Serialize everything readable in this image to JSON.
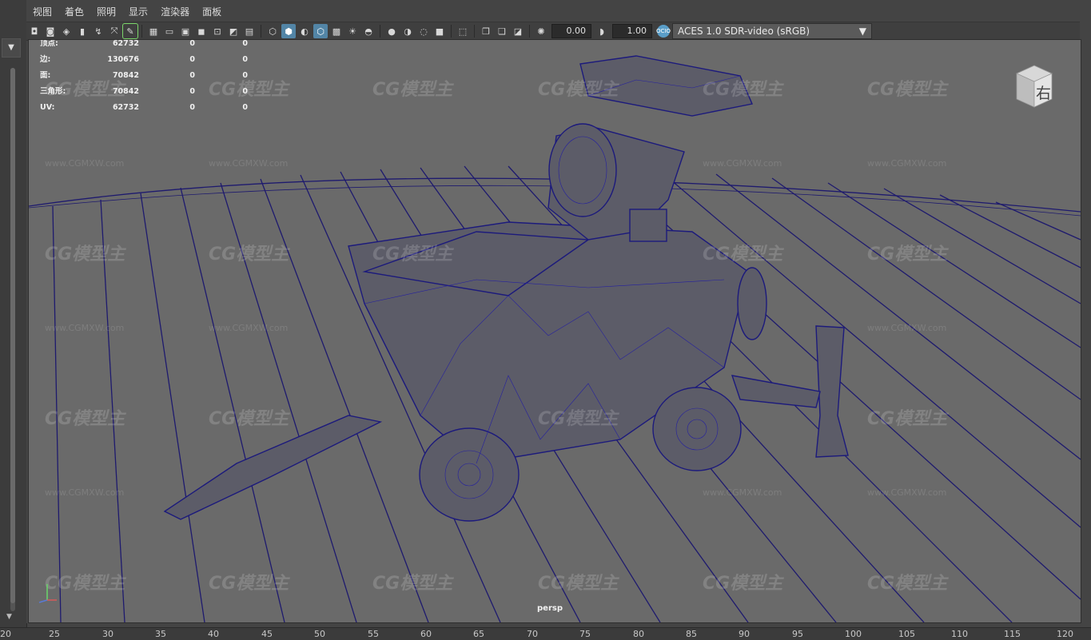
{
  "menu": [
    "视图",
    "着色",
    "照明",
    "显示",
    "渲染器",
    "面板"
  ],
  "toolbar": {
    "exposure": "0.00",
    "gamma": "1.00",
    "color_space": "ACES 1.0 SDR-video (sRGB)"
  },
  "stats": [
    {
      "label": "顶点:",
      "v1": "62732",
      "v2": "0",
      "v3": "0"
    },
    {
      "label": "边:",
      "v1": "130676",
      "v2": "0",
      "v3": "0"
    },
    {
      "label": "面:",
      "v1": "70842",
      "v2": "0",
      "v3": "0"
    },
    {
      "label": "三角形:",
      "v1": "70842",
      "v2": "0",
      "v3": "0"
    },
    {
      "label": "UV:",
      "v1": "62732",
      "v2": "0",
      "v3": "0"
    }
  ],
  "camera": "persp",
  "viewcube_face": "右",
  "watermark": {
    "brand": "CG模型主",
    "url": "www.CGMXW.com"
  },
  "timeline_ticks": [
    "20",
    "25",
    "30",
    "35",
    "40",
    "45",
    "50",
    "55",
    "60",
    "65",
    "70",
    "75",
    "80",
    "85",
    "90",
    "95",
    "100",
    "105",
    "110",
    "115",
    "120"
  ]
}
